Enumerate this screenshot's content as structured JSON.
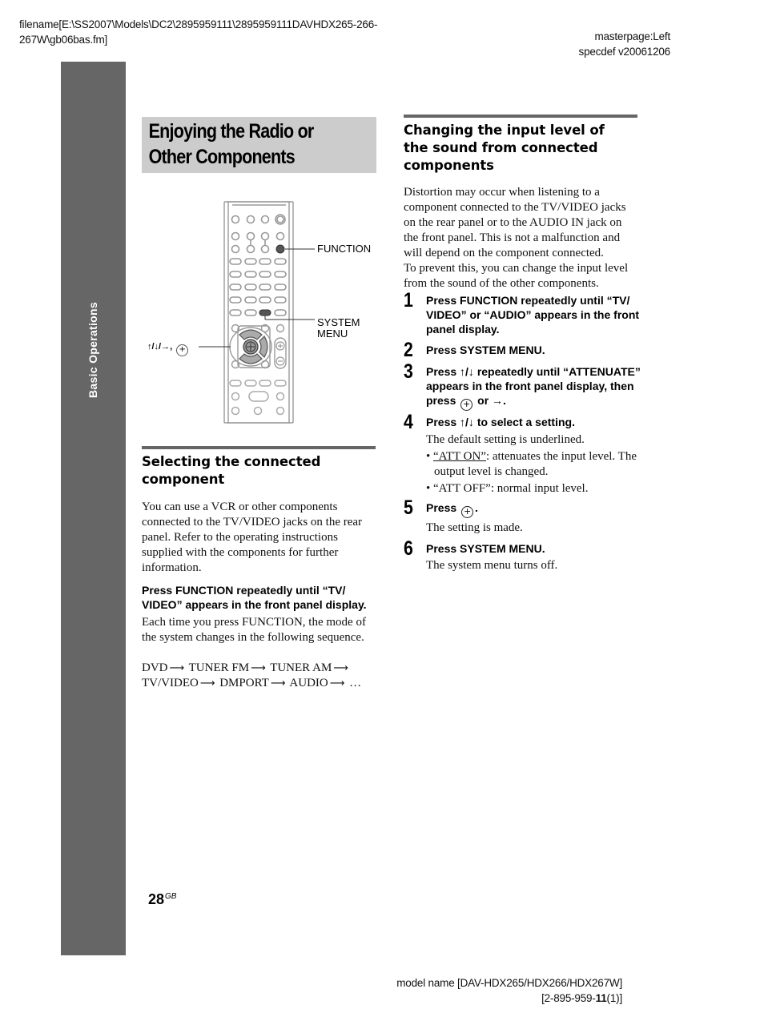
{
  "header": {
    "filename_line1": "filename[E:\\SS2007\\Models\\DC2\\2895959111\\2895959111DAVHDX265-266-",
    "filename_line2": "267W\\gb06bas.fm]",
    "masterpage": "masterpage:Left",
    "specdef": "specdef v20061206"
  },
  "sidebar": {
    "label": "Basic Operations"
  },
  "title": {
    "line1": "Enjoying the Radio or",
    "line2": "Other Components"
  },
  "illustration": {
    "callouts": {
      "function": "FUNCTION",
      "system_menu_line1": "SYSTEM",
      "system_menu_line2": "MENU",
      "arrows": "↑/↓/→,"
    }
  },
  "left_section": {
    "heading_line1": "Selecting the connected",
    "heading_line2": "component",
    "intro": "You can use a VCR or other components connected to the TV/VIDEO jacks on the rear panel. Refer to the operating instructions supplied with the components for further information.",
    "instruction": "Press FUNCTION repeatedly until “TV/ VIDEO” appears in the front panel display.",
    "explanation": "Each time you press FUNCTION, the mode of the system changes in the following sequence.",
    "sequence": [
      "DVD",
      "TUNER FM",
      "TUNER AM",
      "TV/VIDEO",
      "DMPORT",
      "AUDIO",
      "…"
    ]
  },
  "right_section": {
    "heading_line1": "Changing the input level of",
    "heading_line2": "the sound from connected",
    "heading_line3": "components",
    "intro1": "Distortion may occur when listening to a component connected to the TV/VIDEO jacks on the rear panel or to the AUDIO IN jack on the front panel. This is not a malfunction and will depend on the component connected.",
    "intro2": "To prevent this, you can change the input level from the sound of the other components.",
    "steps": [
      {
        "num": "1",
        "text": "Press FUNCTION repeatedly until “TV/ VIDEO” or “AUDIO” appears in the front panel display."
      },
      {
        "num": "2",
        "text": "Press SYSTEM MENU."
      },
      {
        "num": "3",
        "text_a": "Press ↑/↓ repeatedly until “ATTENUATE” appears in the front panel display, then press",
        "text_b": "or →."
      },
      {
        "num": "4",
        "text": "Press ↑/↓ to select a setting.",
        "note": "The default setting is underlined.",
        "options": [
          {
            "name": "“ATT ON”",
            "desc": ": attenuates the input level. The output level is changed.",
            "default": true
          },
          {
            "name": "“ATT OFF”",
            "desc": ": normal input level.",
            "default": false
          }
        ]
      },
      {
        "num": "5",
        "text": "Press",
        "text_end": ".",
        "note": "The setting is made."
      },
      {
        "num": "6",
        "text": "Press SYSTEM MENU.",
        "note": "The system menu turns off."
      }
    ]
  },
  "footer": {
    "page_number": "28",
    "page_suffix": "GB",
    "model_name": "model name [DAV-HDX265/HDX266/HDX267W]",
    "code_prefix": "[2-895-959-",
    "code_bold": "11",
    "code_suffix": "(1)]"
  }
}
